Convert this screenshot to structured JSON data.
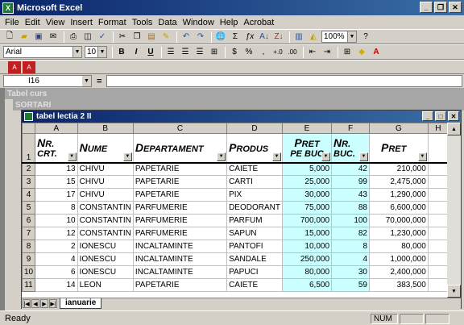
{
  "app": {
    "title": "Microsoft Excel"
  },
  "menu": [
    "File",
    "Edit",
    "View",
    "Insert",
    "Format",
    "Tools",
    "Data",
    "Window",
    "Help",
    "Acrobat"
  ],
  "toolbar": {
    "zoom": "100%",
    "font": "Arial",
    "size": "10"
  },
  "formula": {
    "cell": "I16",
    "eq": "="
  },
  "windows": {
    "back1": "Tabel curs",
    "back2": "SORTARI",
    "front": "tabel lectia 2 II"
  },
  "columns": [
    "A",
    "B",
    "C",
    "D",
    "E",
    "F",
    "G",
    "H"
  ],
  "headers": {
    "a1": "N",
    "a2": "R.",
    "a3": "CRT.",
    "b1": "N",
    "b2": "UME",
    "c1": "D",
    "c2": "EPARTAMENT",
    "d1": "P",
    "d2": "RODUS",
    "e1": "P",
    "e2": "RET",
    "e3": "PE BUC",
    "f1": "N",
    "f2": "R.",
    "f3": "BUC.",
    "g1": "P",
    "g2": "RET"
  },
  "rows": [
    {
      "r": "2",
      "a": "13",
      "b": "CHIVU",
      "c": "PAPETARIE",
      "d": "CAIETE",
      "e": "5,000",
      "f": "42",
      "g": "210,000"
    },
    {
      "r": "3",
      "a": "15",
      "b": "CHIVU",
      "c": "PAPETARIE",
      "d": "CARTI",
      "e": "25,000",
      "f": "99",
      "g": "2,475,000"
    },
    {
      "r": "4",
      "a": "17",
      "b": "CHIVU",
      "c": "PAPETARIE",
      "d": "PIX",
      "e": "30,000",
      "f": "43",
      "g": "1,290,000"
    },
    {
      "r": "5",
      "a": "8",
      "b": "CONSTANTIN",
      "c": "PARFUMERIE",
      "d": "DEODORANT",
      "e": "75,000",
      "f": "88",
      "g": "6,600,000"
    },
    {
      "r": "6",
      "a": "10",
      "b": "CONSTANTIN",
      "c": "PARFUMERIE",
      "d": "PARFUM",
      "e": "700,000",
      "f": "100",
      "g": "70,000,000"
    },
    {
      "r": "7",
      "a": "12",
      "b": "CONSTANTIN",
      "c": "PARFUMERIE",
      "d": "SAPUN",
      "e": "15,000",
      "f": "82",
      "g": "1,230,000"
    },
    {
      "r": "8",
      "a": "2",
      "b": "IONESCU",
      "c": "INCALTAMINTE",
      "d": "PANTOFI",
      "e": "10,000",
      "f": "8",
      "g": "80,000"
    },
    {
      "r": "9",
      "a": "4",
      "b": "IONESCU",
      "c": "INCALTAMINTE",
      "d": "SANDALE",
      "e": "250,000",
      "f": "4",
      "g": "1,000,000"
    },
    {
      "r": "10",
      "a": "6",
      "b": "IONESCU",
      "c": "INCALTAMINTE",
      "d": "PAPUCI",
      "e": "80,000",
      "f": "30",
      "g": "2,400,000"
    },
    {
      "r": "11",
      "a": "14",
      "b": "LEON",
      "c": "PAPETARIE",
      "d": "CAIETE",
      "e": "6,500",
      "f": "59",
      "g": "383,500"
    }
  ],
  "sheet": {
    "tab": "ianuarie"
  },
  "status": {
    "ready": "Ready",
    "num": "NUM"
  }
}
